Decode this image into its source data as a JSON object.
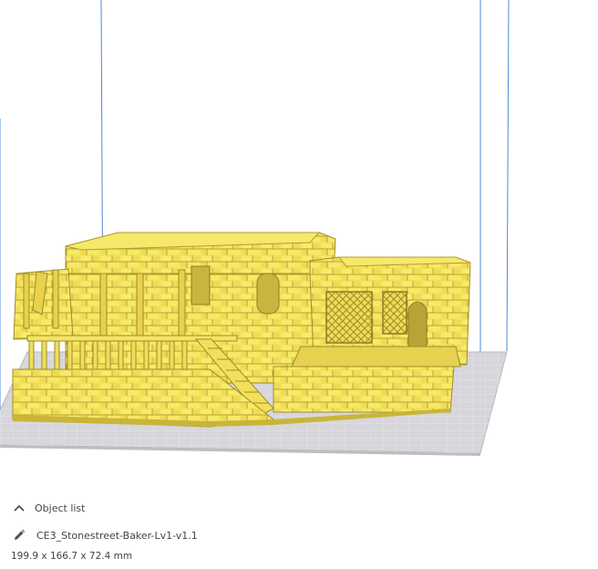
{
  "panel": {
    "toggle_label": "Object list",
    "object_name": "CE3_Stonestreet-Baker-Lv1-v1.1",
    "dimensions": "199.9 x 166.7 x 72.4 mm"
  },
  "colors": {
    "build_volume_line": "#4b8ad6",
    "build_plate": "#c8c8cc",
    "grid_line": "#e8e8ec",
    "model_fill": "#f5e35a",
    "model_shade": "#c9b53a",
    "model_dark": "#9e8c28",
    "text": "#444444"
  },
  "icons": {
    "toggle": "chevron-up-icon",
    "edit": "pencil-icon"
  }
}
